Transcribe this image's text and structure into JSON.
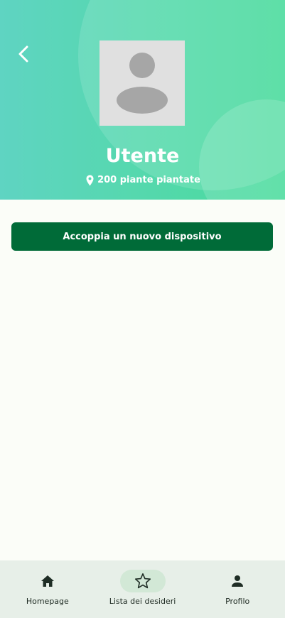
{
  "header": {
    "back_icon": "chevron-left-icon",
    "avatar_icon": "person-placeholder-icon",
    "user_name": "Utente",
    "location_icon": "map-pin-icon",
    "plants_text": "200 piante piantate",
    "gradient_start": "#5fd4c2",
    "gradient_end": "#47db9b"
  },
  "main": {
    "pair_button_label": "Accoppia un nuovo dispositivo",
    "pair_button_color": "#006b38"
  },
  "bottom_nav": {
    "items": [
      {
        "label": "Homepage",
        "icon": "home-icon",
        "active": false
      },
      {
        "label": "Lista dei desideri",
        "icon": "star-outline-icon",
        "active": true
      },
      {
        "label": "Profilo",
        "icon": "person-icon",
        "active": false
      }
    ]
  }
}
